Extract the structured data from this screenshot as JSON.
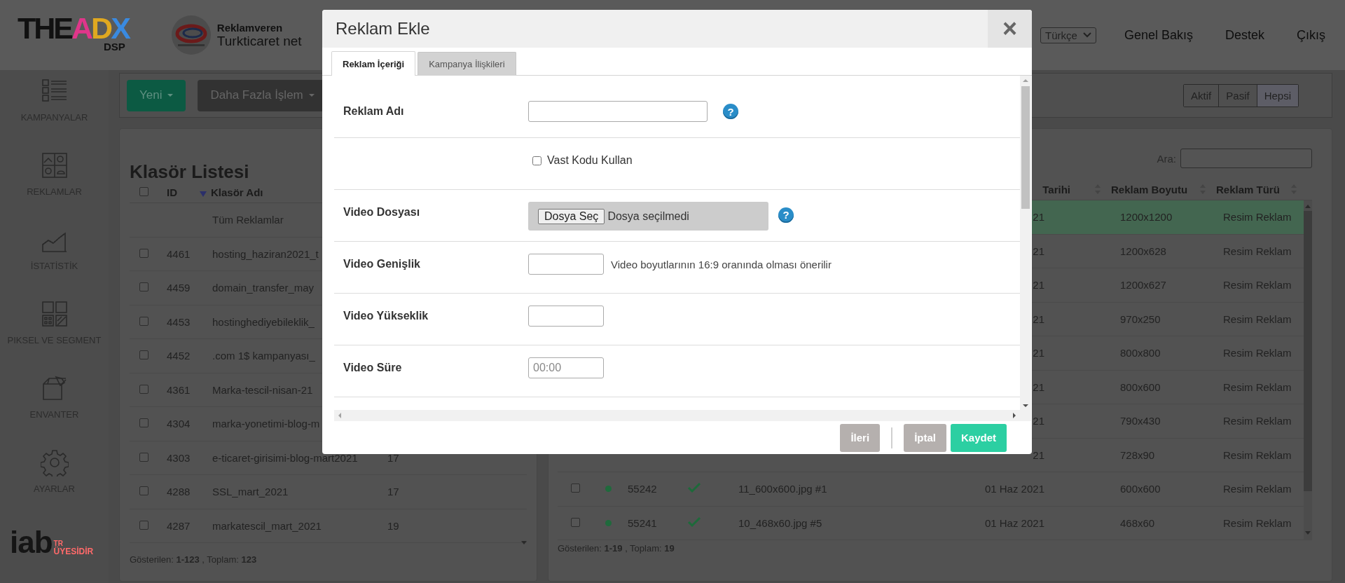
{
  "header": {
    "logo": "THEADX",
    "logo_sub": "DSP",
    "advertiser_label": "Reklamveren",
    "advertiser_name": "Turkticaret net",
    "language": "Türkçe",
    "nav": [
      "Genel Bakış",
      "Destek",
      "Çıkış"
    ]
  },
  "sidebar": {
    "items": [
      "KAMPANYALAR",
      "REKLAMLAR",
      "İSTATİSTİK",
      "PIKSEL VE SEGMENT",
      "ENVANTER",
      "AYARLAR"
    ],
    "badge": {
      "logo": "iab",
      "country": "TR",
      "caption": "ÜYESİDİR"
    }
  },
  "toolbar": {
    "actions": [
      {
        "label": "Yeni",
        "kind": "primary"
      },
      {
        "label": "Daha Fazla İşlem",
        "kind": "dark"
      }
    ],
    "filters": [
      {
        "label": "Aktif",
        "selected": false
      },
      {
        "label": "Pasif",
        "selected": false
      },
      {
        "label": "Hepsi",
        "selected": true
      }
    ]
  },
  "folders": {
    "title": "Klasör Listesi",
    "columns": [
      "ID",
      "Klasör Adı"
    ],
    "header_checked": false,
    "rows": [
      {
        "kind": "all",
        "name": "Tüm Reklamlar"
      },
      {
        "kind": "folder",
        "checked": false,
        "id": "4461",
        "name": "hosting_haziran2021_t"
      },
      {
        "kind": "folder",
        "checked": false,
        "id": "4459",
        "name": "domain_transfer_may"
      },
      {
        "kind": "folder",
        "checked": false,
        "id": "4453",
        "name": "hostinghediyebileklik_"
      },
      {
        "kind": "folder",
        "checked": false,
        "id": "4452",
        "name": ".com 1$ kampanyası_"
      },
      {
        "kind": "folder",
        "checked": false,
        "id": "4361",
        "name": "Marka-tescil-nisan-21"
      },
      {
        "kind": "folder",
        "checked": false,
        "id": "4304",
        "name": "marka-yonetimi-blog-m"
      },
      {
        "kind": "folder",
        "checked": false,
        "id": "4303",
        "name": "e-ticaret-girisimi-blog-mart2021",
        "count": "17"
      },
      {
        "kind": "folder",
        "checked": false,
        "id": "4288",
        "name": "SSL_mart_2021",
        "count": "17"
      },
      {
        "kind": "folder",
        "checked": false,
        "id": "4287",
        "name": "markatescil_mart_2021",
        "count": "19"
      }
    ],
    "footer": "Gösterilen: **1-123** , Toplam: **123**"
  },
  "ads": {
    "search_label": "Ara:",
    "columns": [
      "Tarihi",
      "Reklam Boyutu",
      "Reklam Türü"
    ],
    "rows": [
      {
        "selected": true,
        "date": "21",
        "size": "1200x1200",
        "type": "Resim Reklam"
      },
      {
        "selected": false,
        "date": "21",
        "size": "1200x628",
        "type": "Resim Reklam"
      },
      {
        "selected": false,
        "date": "21",
        "size": "1200x627",
        "type": "Resim Reklam"
      },
      {
        "selected": false,
        "date": "21",
        "size": "970x250",
        "type": "Resim Reklam"
      },
      {
        "selected": false,
        "date": "21",
        "size": "800x800",
        "type": "Resim Reklam"
      },
      {
        "selected": false,
        "date": "21",
        "size": "800x600",
        "type": "Resim Reklam"
      },
      {
        "selected": false,
        "date": "21",
        "size": "790x430",
        "type": "Resim Reklam"
      },
      {
        "selected": false,
        "date": "21",
        "size": "728x90",
        "type": "Resim Reklam"
      },
      {
        "selected": false,
        "checked": false,
        "active": true,
        "id": "55242",
        "approved": true,
        "name": "11_600x600.jpg #1",
        "date": "01 Haz 2021",
        "size": "600x600",
        "type": "Resim Reklam"
      },
      {
        "selected": false,
        "checked": false,
        "active": true,
        "id": "55241",
        "approved": true,
        "name": "10_468x60.jpg #5",
        "date": "01 Haz 2021",
        "size": "468x60",
        "type": "Resim Reklam"
      }
    ],
    "footer": "Gösterilen: **1-19** , Toplam: **19**"
  },
  "modal": {
    "title": "Reklam Ekle",
    "close": "×",
    "tabs": [
      {
        "label": "Reklam İçeriği",
        "selected": true
      },
      {
        "label": "Kampanya İlişkileri",
        "selected": false
      }
    ],
    "fields": [
      {
        "kind": "text",
        "label": "Reklam Adı",
        "help": "?"
      },
      {
        "kind": "checkbox",
        "label": "Vast Kodu Kullan",
        "checked": false
      },
      {
        "kind": "file",
        "label": "Video Dosyası",
        "button": "Dosya Seç",
        "status": "Dosya seçilmedi",
        "help": "?"
      },
      {
        "kind": "number",
        "label": "Video Genişlik",
        "hint": "Video boyutlarının 16:9 oranında olması önerilir"
      },
      {
        "kind": "number",
        "label": "Video Yükseklik"
      },
      {
        "kind": "time",
        "label": "Video Süre",
        "placeholder": "00:00"
      }
    ],
    "button_groups": [
      [
        {
          "label": "İleri",
          "kind": "secondary"
        }
      ],
      [
        {
          "label": "İptal",
          "kind": "secondary"
        },
        {
          "label": "Kaydet",
          "kind": "primary"
        }
      ]
    ]
  }
}
